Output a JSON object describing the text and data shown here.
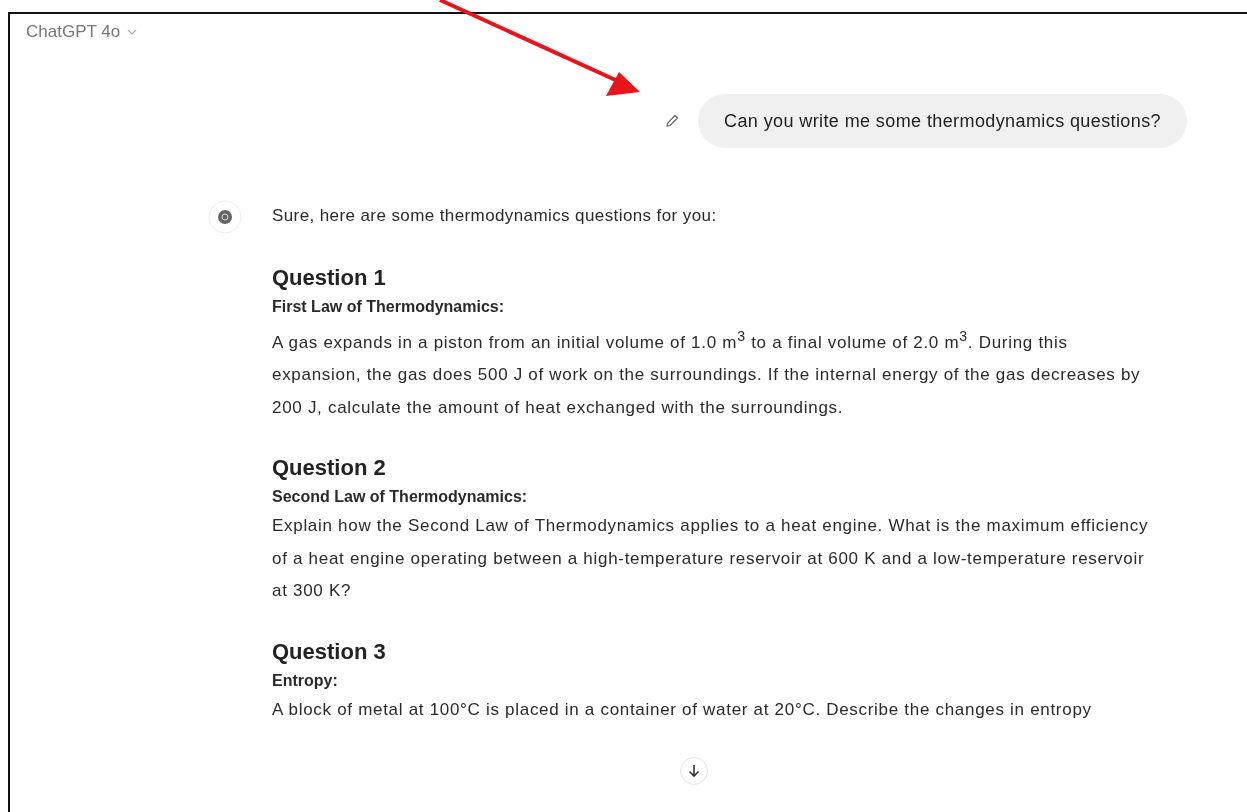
{
  "header": {
    "model": "ChatGPT 4o"
  },
  "user_message": {
    "text": "Can you write me some thermodynamics questions?"
  },
  "assistant": {
    "intro": "Sure, here are some thermodynamics questions for you:",
    "sections": [
      {
        "heading": "Question 1",
        "subheading": "First Law of Thermodynamics:",
        "body": "A gas expands in a piston from an initial volume of 1.0 m$^{3}$ to a final volume of 2.0 m$^{3}$. During this expansion, the gas does 500 J of work on the surroundings. If the internal energy of the gas decreases by 200 J, calculate the amount of heat exchanged with the surroundings."
      },
      {
        "heading": "Question 2",
        "subheading": "Second Law of Thermodynamics:",
        "body": "Explain how the Second Law of Thermodynamics applies to a heat engine. What is the maximum efficiency of a heat engine operating between a high-temperature reservoir at 600 K and a low-temperature reservoir at 300 K?"
      },
      {
        "heading": "Question 3",
        "subheading": "Entropy:",
        "body": "A block of metal at 100°C is placed in a container of water at 20°C. Describe the changes in entropy"
      }
    ]
  }
}
